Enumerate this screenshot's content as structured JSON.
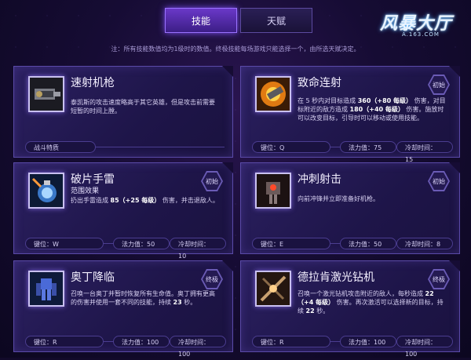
{
  "tabs": {
    "skills": "技能",
    "talents": "天赋"
  },
  "logo": {
    "text": "风暴大厅",
    "url": "A.163.COM"
  },
  "note": "注：所有技能数值均为1级时的数值。终极技能每场游戏只能选择一个，由所选天赋决定。",
  "cards": [
    {
      "name": "速射机枪",
      "desc": "泰凯斯的攻击速度略高于其它英雄，但是攻击前需要短暂的时间上膛。",
      "tag": "战斗特质"
    },
    {
      "name": "致命连射",
      "badge": "初始",
      "desc_a": "在 5 秒内对目标造成 ",
      "desc_b": "360（+80 每级）",
      "desc_c": " 伤害，对目标附近的敌方造成 ",
      "desc_d": "180（+40 每级）",
      "desc_e": " 伤害。施放时可以改变目标，引导时可以移动或使用技能。",
      "key": "键位：Q",
      "mana": "法力值：75",
      "cd": "冷却时间：15"
    },
    {
      "name": "破片手雷",
      "sub": "范围效果",
      "badge": "初始",
      "desc_a": "扔出手雷造成 ",
      "desc_b": "85（+25 每级）",
      "desc_c": " 伤害，并击退敌人。",
      "key": "键位：W",
      "mana": "法力值：50",
      "cd": "冷却时间：10"
    },
    {
      "name": "冲刺射击",
      "badge": "初始",
      "desc": "向前冲锋并立即准备好机枪。",
      "key": "键位：E",
      "mana": "法力值：50",
      "cd": "冷却时间：8"
    },
    {
      "name": "奥丁降临",
      "badge": "终极",
      "desc_a": "召唤一台奥丁并暂时恢复所有生命值。奥丁拥有更高的伤害并使用一套不同的技能，持续 ",
      "desc_b": "23",
      "desc_c": " 秒。",
      "key": "键位：R",
      "mana": "法力值：100",
      "cd": "冷却时间：100"
    },
    {
      "name": "德拉肯激光钻机",
      "badge": "终极",
      "desc_a": "召唤一个激光钻机攻击附近的敌人，每秒造成 ",
      "desc_b": "22（+4 每级）",
      "desc_c": " 伤害。再次激活可以选择新的目标，持续 ",
      "desc_d": "22",
      "desc_e": " 秒。",
      "key": "键位：R",
      "mana": "法力值：100",
      "cd": "冷却时间：100"
    }
  ]
}
